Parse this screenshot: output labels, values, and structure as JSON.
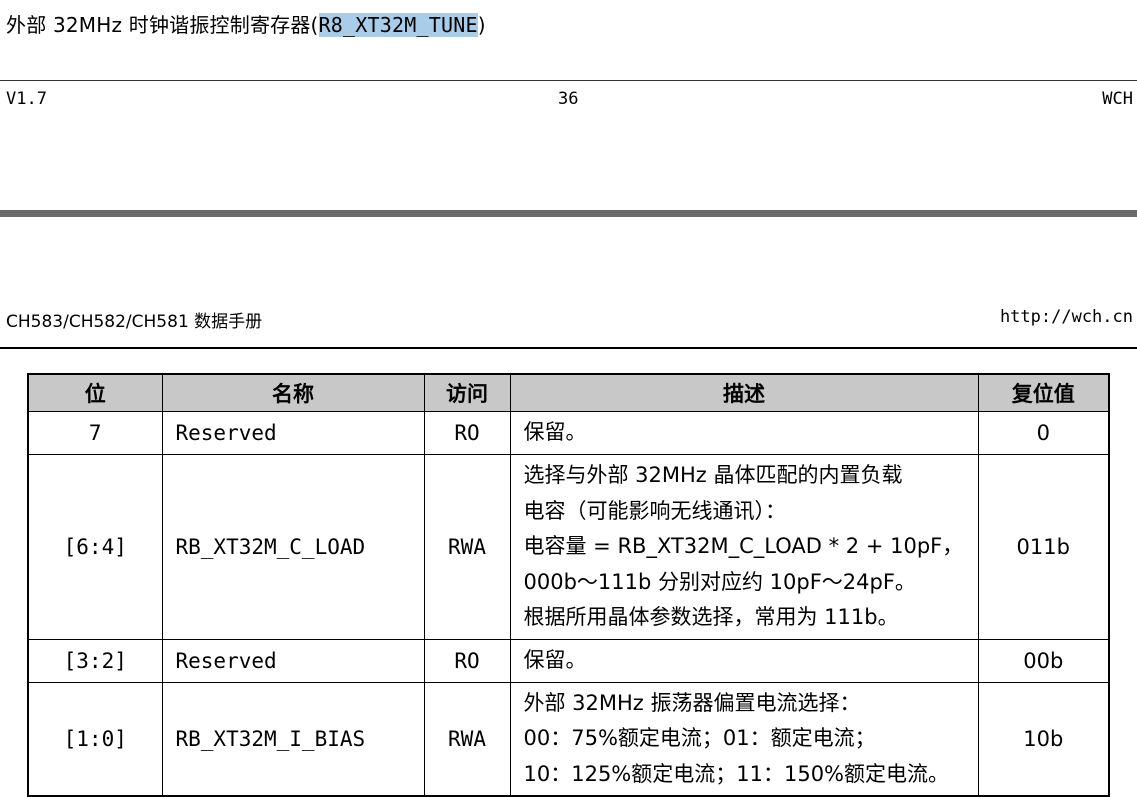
{
  "previous_page": {
    "title_prefix": "外部 32MHz 时钟谐振控制寄存器(",
    "title_register": "R8_XT32M_TUNE",
    "title_suffix": ")",
    "version": "V1.7",
    "page_number": "36",
    "company": "WCH"
  },
  "header": {
    "doc_title": "CH583/CH582/CH581 数据手册",
    "url": "http://wch.cn"
  },
  "table": {
    "headers": [
      "位",
      "名称",
      "访问",
      "描述",
      "复位值"
    ],
    "rows": [
      {
        "bit": "7",
        "name": "Reserved",
        "access": "RO",
        "desc": [
          "保留。"
        ],
        "reset": "0"
      },
      {
        "bit": "[6:4]",
        "name": "RB_XT32M_C_LOAD",
        "access": "RWA",
        "desc": [
          "选择与外部 32MHz 晶体匹配的内置负载",
          "电容（可能影响无线通讯）：",
          "电容量 = RB_XT32M_C_LOAD * 2 + 10pF，",
          "000b～111b 分别对应约 10pF～24pF。",
          "根据所用晶体参数选择，常用为 111b。"
        ],
        "reset": "011b"
      },
      {
        "bit": "[3:2]",
        "name": "Reserved",
        "access": "RO",
        "desc": [
          "保留。"
        ],
        "reset": "00b"
      },
      {
        "bit": "[1:0]",
        "name": "RB_XT32M_I_BIAS",
        "access": "RWA",
        "desc": [
          "外部 32MHz 振荡器偏置电流选择：",
          "00：75%额定电流；01：额定电流；",
          "10：125%额定电流；11：150%额定电流。"
        ],
        "reset": "10b"
      }
    ]
  },
  "colors": {
    "highlight": "#a9cde8",
    "header_bg": "#c8c8c8",
    "page_break_bar": "#6a6a6a"
  }
}
